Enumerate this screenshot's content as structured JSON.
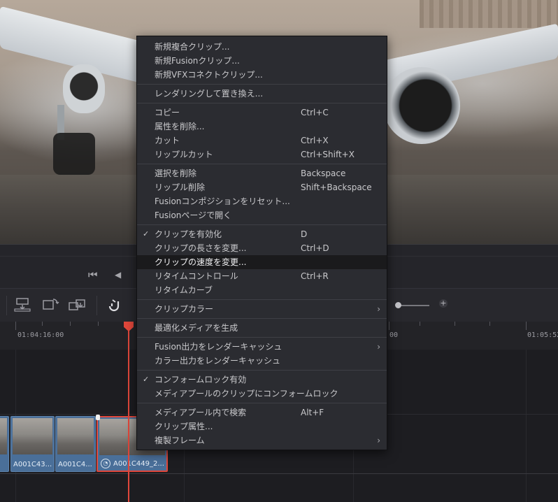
{
  "viewer": {
    "image_desc": "airliner-rear-view"
  },
  "transport": {
    "skip_start_icon": "⏮",
    "prev_icon": "◀"
  },
  "toolbar": {
    "zoom_plus": "+"
  },
  "ruler": {
    "timecodes": [
      "01:04:16:00",
      "00",
      "01:05:52"
    ]
  },
  "clips": [
    {
      "label": "A001C43..."
    },
    {
      "label": "A001C4..."
    },
    {
      "label": "A001C449_2..."
    }
  ],
  "menu": {
    "groups": [
      [
        {
          "label": "新規複合クリップ...",
          "shortcut": ""
        },
        {
          "label": "新規Fusionクリップ...",
          "shortcut": ""
        },
        {
          "label": "新規VFXコネクトクリップ...",
          "shortcut": ""
        }
      ],
      [
        {
          "label": "レンダリングして置き換え...",
          "shortcut": ""
        }
      ],
      [
        {
          "label": "コピー",
          "shortcut": "Ctrl+C"
        },
        {
          "label": "属性を削除...",
          "shortcut": ""
        },
        {
          "label": "カット",
          "shortcut": "Ctrl+X"
        },
        {
          "label": "リップルカット",
          "shortcut": "Ctrl+Shift+X"
        }
      ],
      [
        {
          "label": "選択を削除",
          "shortcut": "Backspace"
        },
        {
          "label": "リップル削除",
          "shortcut": "Shift+Backspace"
        },
        {
          "label": "Fusionコンポジションをリセット...",
          "shortcut": ""
        },
        {
          "label": "Fusionページで開く",
          "shortcut": ""
        }
      ],
      [
        {
          "label": "クリップを有効化",
          "shortcut": "D",
          "checked": "✓"
        },
        {
          "label": "クリップの長さを変更...",
          "shortcut": "Ctrl+D"
        },
        {
          "label": "クリップの速度を変更...",
          "shortcut": ""
        },
        {
          "label": "リタイムコントロール",
          "shortcut": "Ctrl+R"
        },
        {
          "label": "リタイムカーブ",
          "shortcut": ""
        }
      ],
      [
        {
          "label": "クリップカラー",
          "shortcut": "",
          "submenu": "›"
        }
      ],
      [
        {
          "label": "最適化メディアを生成",
          "shortcut": ""
        }
      ],
      [
        {
          "label": "Fusion出力をレンダーキャッシュ",
          "shortcut": "",
          "submenu": "›"
        },
        {
          "label": "カラー出力をレンダーキャッシュ",
          "shortcut": ""
        }
      ],
      [
        {
          "label": "コンフォームロック有効",
          "shortcut": "",
          "checked": "✓"
        },
        {
          "label": "メディアプールのクリップにコンフォームロック",
          "shortcut": ""
        }
      ],
      [
        {
          "label": "メディアプール内で検索",
          "shortcut": "Alt+F"
        },
        {
          "label": "クリップ属性...",
          "shortcut": ""
        },
        {
          "label": "複製フレーム",
          "shortcut": "",
          "submenu": "›"
        }
      ]
    ]
  }
}
